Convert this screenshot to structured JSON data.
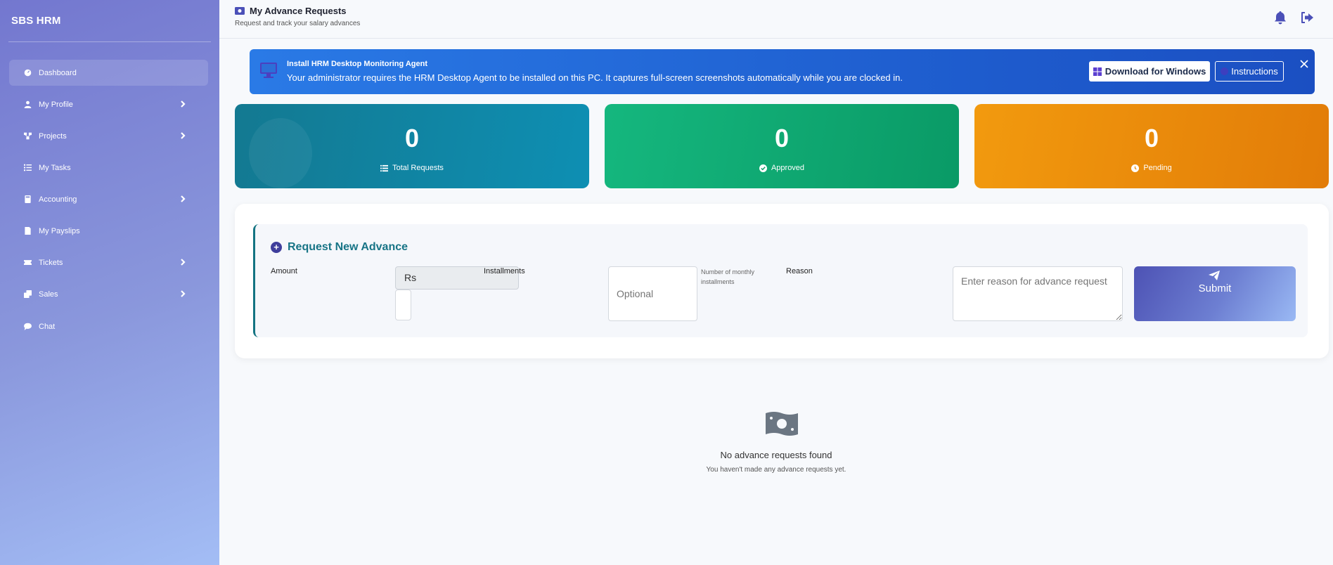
{
  "app": {
    "brand": "SBS HRM"
  },
  "sidebar": {
    "items": [
      {
        "label": "Dashboard",
        "icon": "gauge-icon",
        "has_submenu": false,
        "active": true
      },
      {
        "label": "My Profile",
        "icon": "user-icon",
        "has_submenu": true
      },
      {
        "label": "Projects",
        "icon": "sitemap-icon",
        "has_submenu": true
      },
      {
        "label": "My Tasks",
        "icon": "list-check-icon",
        "has_submenu": false
      },
      {
        "label": "Accounting",
        "icon": "calculator-icon",
        "has_submenu": true
      },
      {
        "label": "My Payslips",
        "icon": "file-invoice-icon",
        "has_submenu": false
      },
      {
        "label": "Tickets",
        "icon": "ticket-icon",
        "has_submenu": true
      },
      {
        "label": "Sales",
        "icon": "clone-icon",
        "has_submenu": true
      },
      {
        "label": "Chat",
        "icon": "comment-icon",
        "has_submenu": false
      }
    ]
  },
  "header": {
    "title": "My Advance Requests",
    "subtitle": "Request and track your salary advances",
    "title_icon": "money-bill-icon"
  },
  "banner": {
    "title": "Install HRM Desktop Monitoring Agent",
    "text": "Your administrator requires the HRM Desktop Agent to be installed on this PC. It captures full-screen screenshots automatically while you are clocked in.",
    "download_label": "Download for Windows",
    "instructions_label": "Instructions"
  },
  "stats": {
    "total": {
      "value": "0",
      "label": "Total Requests",
      "color": "#0e8fb3"
    },
    "approved": {
      "value": "0",
      "label": "Approved",
      "color": "#0a9a66"
    },
    "pending": {
      "value": "0",
      "label": "Pending",
      "color": "#e27c08"
    }
  },
  "form": {
    "title": "Request New Advance",
    "amount_label": "Amount",
    "currency_prefix": "Rs",
    "installments_label": "Installments",
    "installments_placeholder": "Optional",
    "installments_hint": "Number of monthly installments",
    "reason_label": "Reason",
    "reason_placeholder": "Enter reason for advance request",
    "submit_label": "Submit"
  },
  "empty_state": {
    "icon": "money-bill-icon",
    "title": "No advance requests found",
    "subtitle": "You haven't made any advance requests yet."
  },
  "colors": {
    "sidebar_start": "#7377cf",
    "sidebar_end": "#a3bdf5",
    "accent": "#4b50b8",
    "banner": "#1f5fd0",
    "form_title": "#177486"
  }
}
